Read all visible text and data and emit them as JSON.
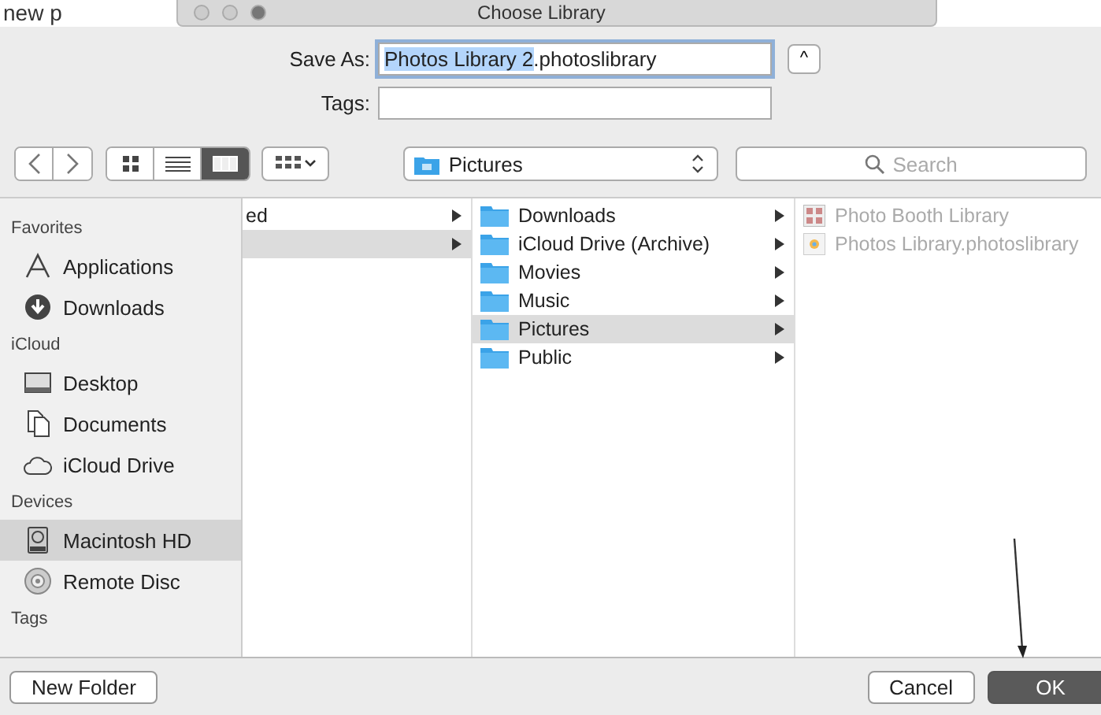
{
  "background_text": "new p",
  "window": {
    "title": "Choose Library"
  },
  "save_as": {
    "label": "Save As:",
    "value_selected": "Photos Library 2",
    "value_rest": ".photoslibrary",
    "expand_symbol": "^"
  },
  "tags_field": {
    "label": "Tags:"
  },
  "toolbar": {
    "view_modes": [
      {
        "kind": "icons",
        "selected": false
      },
      {
        "kind": "list",
        "selected": false
      },
      {
        "kind": "columns",
        "selected": true
      }
    ],
    "location": "Pictures",
    "search": {
      "placeholder": "Search"
    }
  },
  "sidebar": [
    {
      "kind": "header",
      "label": "Favorites"
    },
    {
      "kind": "applications",
      "label": "Applications",
      "selected": false
    },
    {
      "kind": "downloads",
      "label": "Downloads",
      "selected": false
    },
    {
      "kind": "header",
      "label": "iCloud"
    },
    {
      "kind": "desktop",
      "label": "Desktop",
      "selected": false
    },
    {
      "kind": "documents",
      "label": "Documents",
      "selected": false
    },
    {
      "kind": "cloud",
      "label": "iCloud Drive",
      "selected": false
    },
    {
      "kind": "header",
      "label": "Devices"
    },
    {
      "kind": "disk",
      "label": "Macintosh HD",
      "selected": true
    },
    {
      "kind": "disc",
      "label": "Remote Disc",
      "selected": false
    },
    {
      "kind": "header",
      "label": "Tags"
    }
  ],
  "columns": [
    {
      "items": [
        {
          "label": "ed",
          "kind": "plain",
          "selected": false,
          "has_children": true,
          "disabled": false
        },
        {
          "kind": "plain",
          "selected": true,
          "has_children": true,
          "disabled": false
        }
      ]
    },
    {
      "items": [
        {
          "label": "Downloads",
          "kind": "folder",
          "selected": false,
          "has_children": true,
          "disabled": false
        },
        {
          "label": "iCloud Drive (Archive)",
          "kind": "folder",
          "selected": false,
          "has_children": true,
          "disabled": false
        },
        {
          "label": "Movies",
          "kind": "folder",
          "selected": false,
          "has_children": true,
          "disabled": false
        },
        {
          "label": "Music",
          "kind": "folder",
          "selected": false,
          "has_children": true,
          "disabled": false
        },
        {
          "label": "Pictures",
          "kind": "folder",
          "selected": true,
          "has_children": true,
          "disabled": false
        },
        {
          "label": "Public",
          "kind": "folder",
          "selected": false,
          "has_children": true,
          "disabled": false
        }
      ]
    },
    {
      "items": [
        {
          "label": "Photo Booth Library",
          "kind": "booth",
          "selected": false,
          "has_children": false,
          "disabled": true
        },
        {
          "label": "Photos Library.photoslibrary",
          "kind": "photos",
          "selected": false,
          "has_children": false,
          "disabled": true
        }
      ]
    }
  ],
  "buttons": {
    "new_folder": "New Folder",
    "cancel": "Cancel",
    "ok": "OK"
  }
}
